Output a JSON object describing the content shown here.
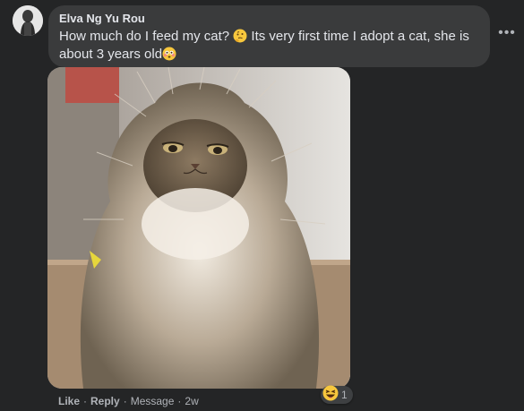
{
  "comment": {
    "author": "Elva Ng Yu Rou",
    "text_part1": "How much do I feed my cat? ",
    "text_part2": " Its very first time I adopt a cat, she is about 3 years old",
    "emoji_1": "thinking-face-icon",
    "emoji_2": "flushed-face-icon"
  },
  "more_options": "•••",
  "attachment": {
    "kind": "photo",
    "subject": "fluffy long-haired cat"
  },
  "actions": {
    "like": "Like",
    "reply": "Reply",
    "message": "Message",
    "time": "2w",
    "separator": "·"
  },
  "reactions": {
    "icon": "laughing-face-icon",
    "count": "1"
  },
  "colors": {
    "background": "#242526",
    "bubble": "#3a3b3c",
    "text_primary": "#e4e6eb",
    "text_secondary": "#b0b3b8"
  }
}
